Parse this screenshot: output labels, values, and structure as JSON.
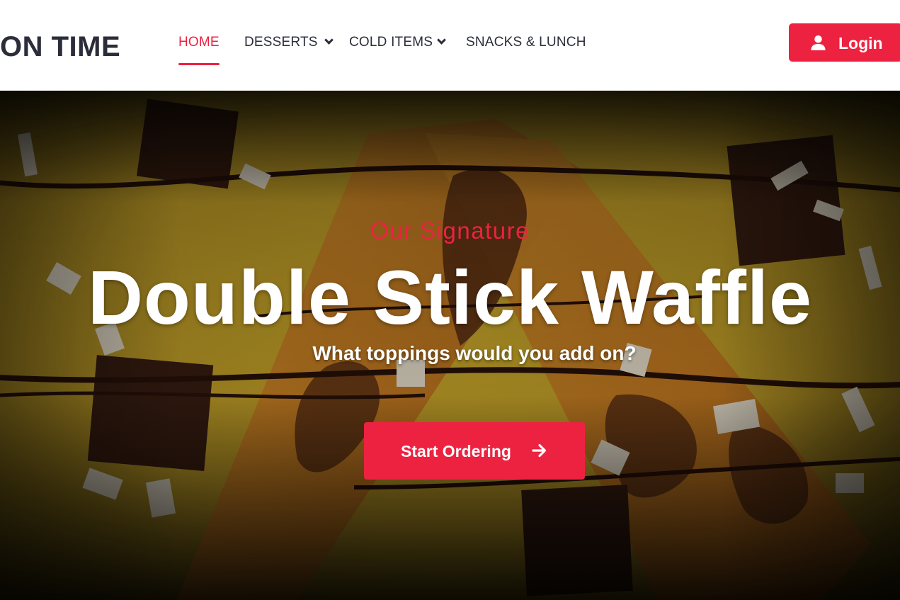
{
  "brand": {
    "name": "ON TIME"
  },
  "nav": {
    "items": [
      {
        "label": "HOME",
        "active": true,
        "has_dropdown": false
      },
      {
        "label": "DESSERTS",
        "active": false,
        "has_dropdown": true
      },
      {
        "label": "COLD ITEMS",
        "active": false,
        "has_dropdown": true
      },
      {
        "label": "SNACKS & LUNCH",
        "active": false,
        "has_dropdown": false
      }
    ]
  },
  "login": {
    "label": "Login",
    "icon": "user-icon"
  },
  "hero": {
    "eyebrow": "Our Signature",
    "title": "Double Stick Waffle",
    "subtitle": "What toppings would you add on?",
    "cta_label": "Start Ordering",
    "cta_icon": "arrow-right-icon",
    "background": "waffle-photo"
  },
  "colors": {
    "accent": "#ed2240",
    "text_dark": "#2b2d3a",
    "hero_mustard": "#c9a62a"
  }
}
